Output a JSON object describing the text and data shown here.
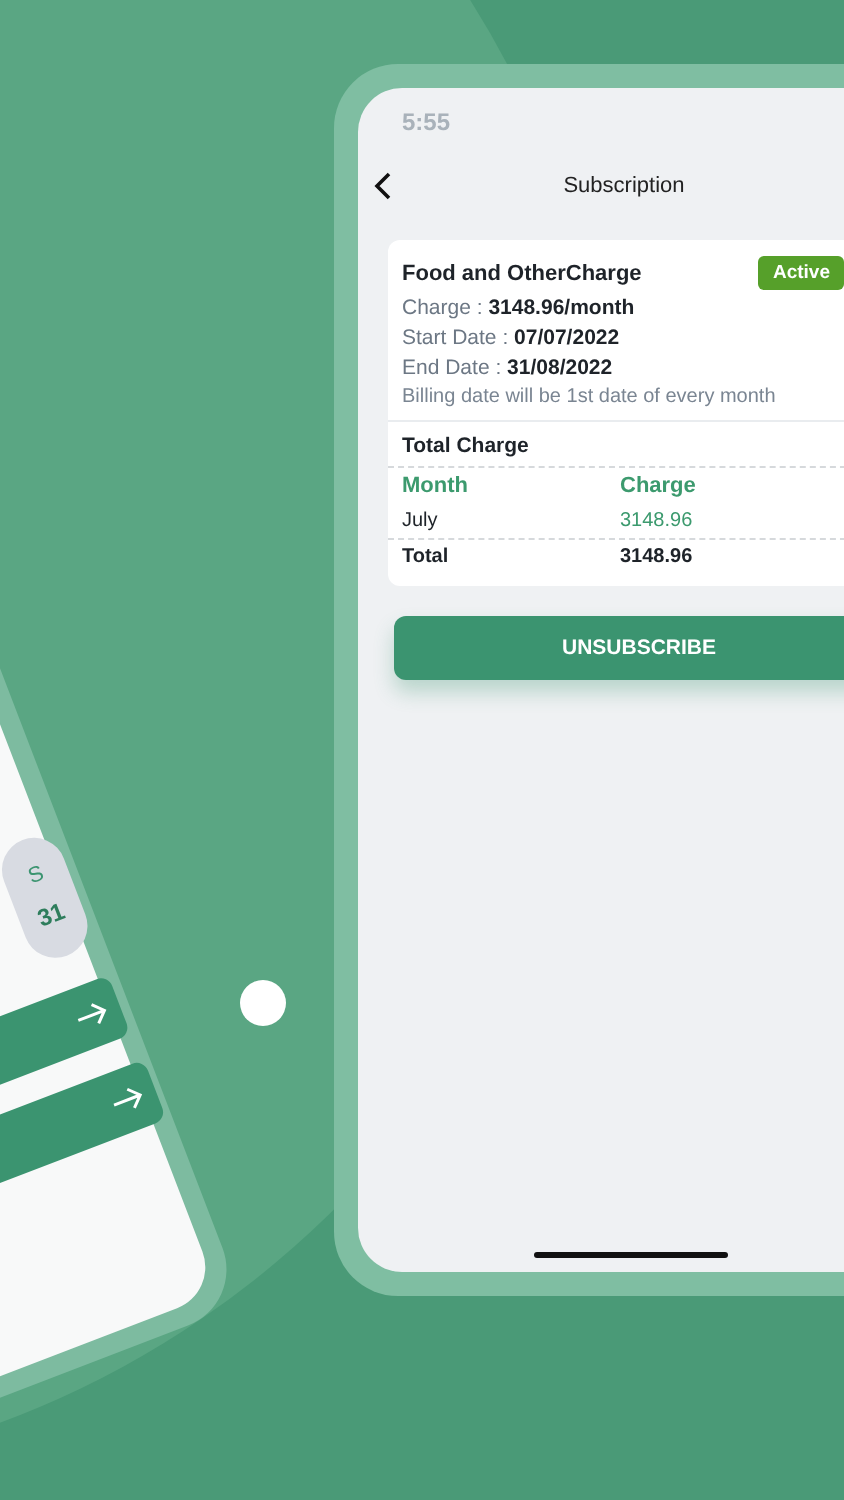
{
  "tilted_phone": {
    "day_letter": "S",
    "day_number": "31"
  },
  "status_bar": {
    "time": "5:55"
  },
  "nav": {
    "title": "Subscription"
  },
  "subscription": {
    "name": "Food and OtherCharge",
    "status": "Active",
    "fields": [
      {
        "label": "Charge :",
        "value": "3148.96/month"
      },
      {
        "label": "Start Date :",
        "value": "07/07/2022"
      },
      {
        "label": "End Date :",
        "value": "31/08/2022"
      }
    ],
    "note": "Billing date will be 1st date of every month"
  },
  "total_charge": {
    "title": "Total Charge",
    "columns": [
      "Month",
      "Charge"
    ],
    "rows": [
      {
        "month": "July",
        "charge": "3148.96"
      }
    ],
    "total": {
      "label": "Total",
      "value": "3148.96"
    }
  },
  "buttons": [
    {
      "label": "UNSUBSCRIBE"
    }
  ]
}
